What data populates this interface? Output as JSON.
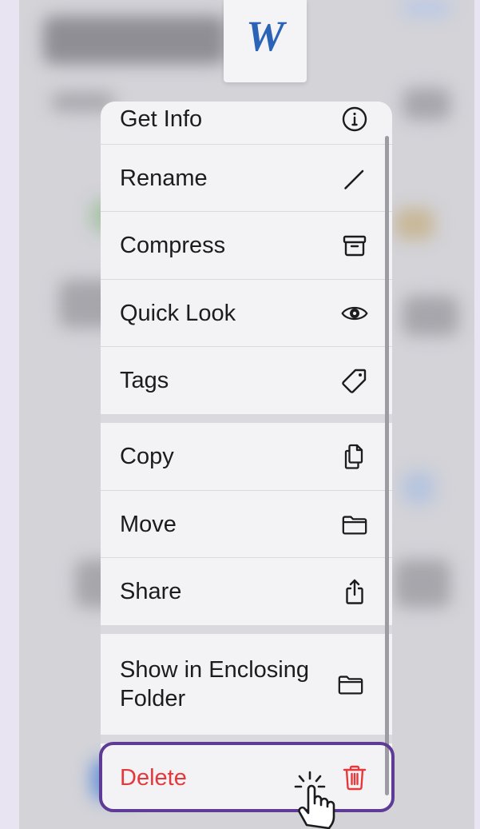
{
  "document": {
    "thumbnail_letter": "W"
  },
  "menu": {
    "group1": [
      {
        "label": "Get Info",
        "icon": "info-icon"
      },
      {
        "label": "Rename",
        "icon": "pencil-icon"
      },
      {
        "label": "Compress",
        "icon": "archive-icon"
      },
      {
        "label": "Quick Look",
        "icon": "eye-icon"
      },
      {
        "label": "Tags",
        "icon": "tag-icon"
      }
    ],
    "group2": [
      {
        "label": "Copy",
        "icon": "copy-icon"
      },
      {
        "label": "Move",
        "icon": "folder-icon"
      },
      {
        "label": "Share",
        "icon": "share-icon"
      }
    ],
    "group3": [
      {
        "label": "Show in Enclosing Folder",
        "icon": "folder-icon"
      }
    ],
    "delete": {
      "label": "Delete",
      "icon": "trash-icon",
      "color": "#e5383b"
    }
  },
  "colors": {
    "highlight_border": "#5e3b94",
    "menu_background": "#f3f3f5",
    "destructive": "#e5383b",
    "thumbnail_letter": "#2b63b7"
  }
}
